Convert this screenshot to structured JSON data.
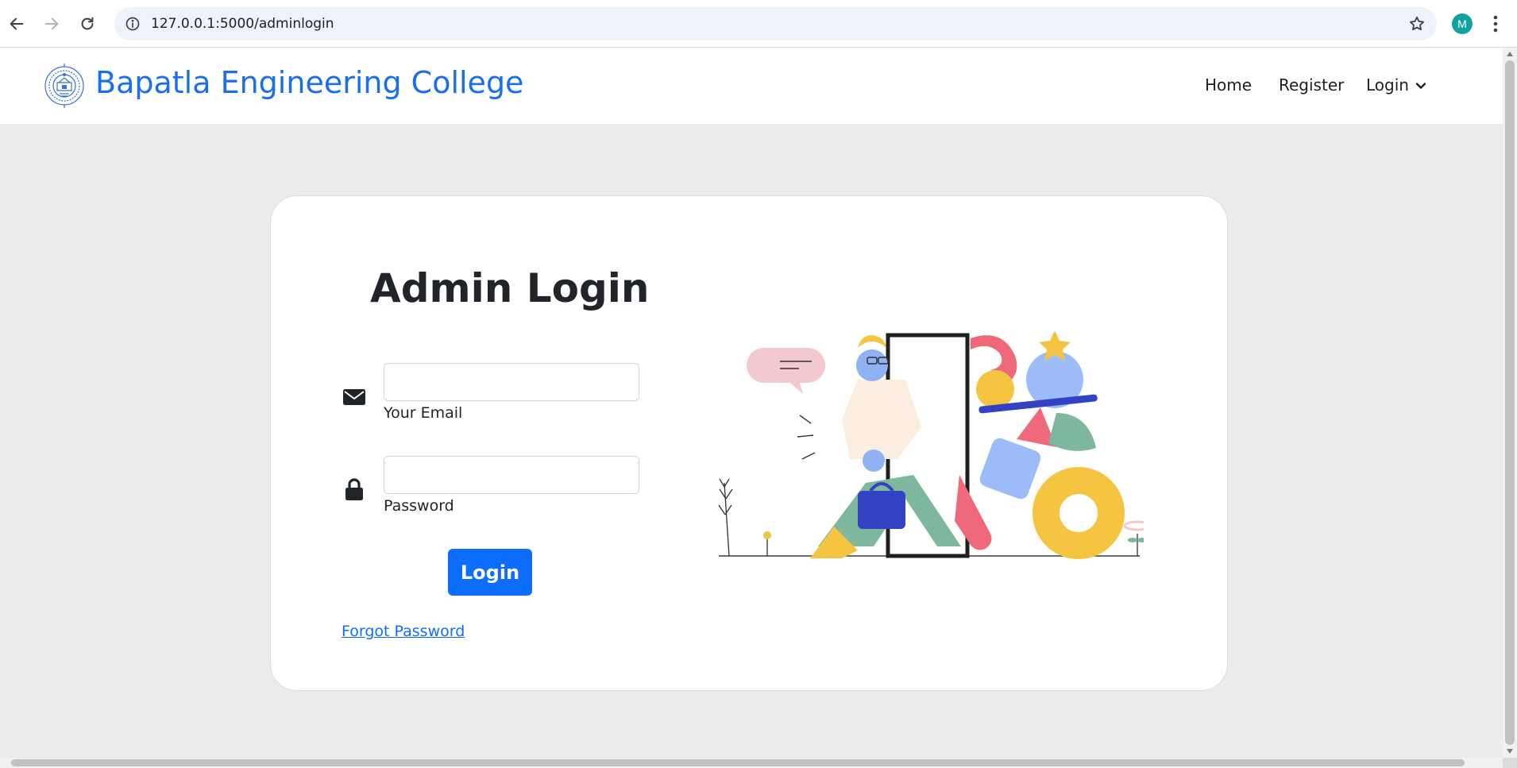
{
  "browser": {
    "url": "127.0.0.1:5000/adminlogin",
    "profile_initial": "M"
  },
  "site": {
    "brand": "Bapatla Engineering College",
    "nav": {
      "home": "Home",
      "register": "Register",
      "login": "Login"
    }
  },
  "form": {
    "title": "Admin Login",
    "email_label": "Your Email",
    "email_value": "",
    "password_label": "Password",
    "password_value": "",
    "submit_label": "Login",
    "forgot_label": "Forgot Password"
  },
  "colors": {
    "brand": "#1a6ff0",
    "primary_button": "#0d6efd",
    "page_background": "#ececec",
    "card_background": "#ffffff"
  },
  "icons": {
    "back": "arrow-left-icon",
    "forward": "arrow-right-icon",
    "reload": "reload-icon",
    "site_info": "info-icon",
    "bookmark": "star-icon",
    "menu": "kebab-icon",
    "login_dropdown": "chevron-down-icon",
    "email": "envelope-icon",
    "password": "lock-icon"
  }
}
